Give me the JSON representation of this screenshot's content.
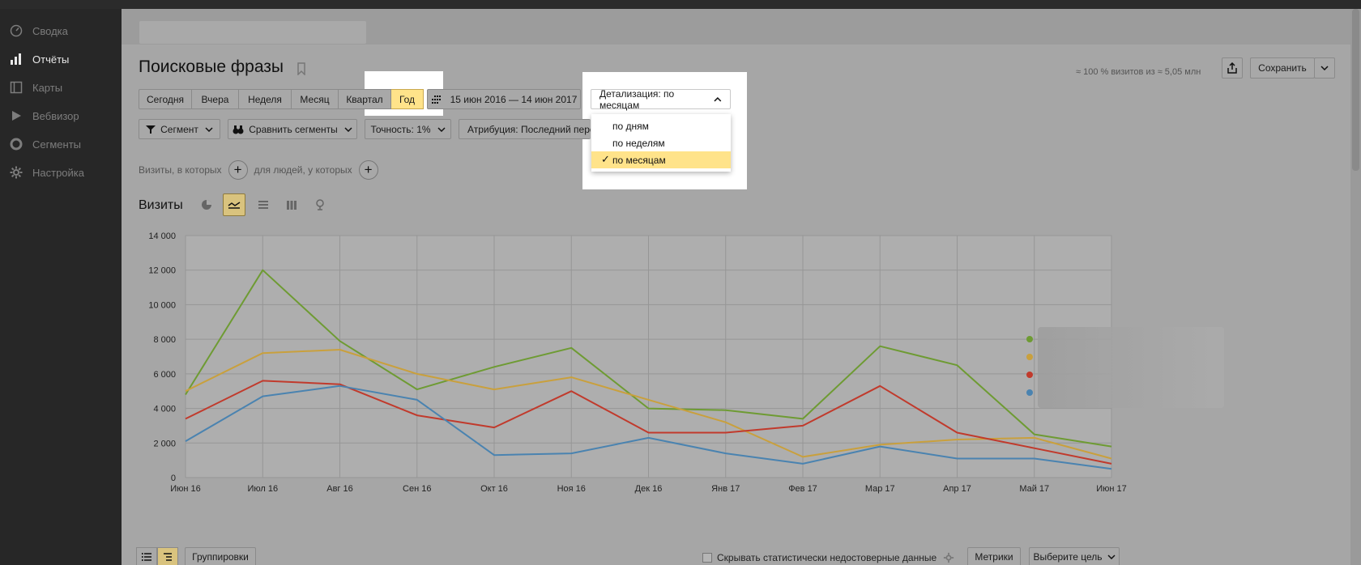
{
  "sidebar": {
    "items": [
      {
        "label": "Сводка",
        "icon": "dashboard-icon"
      },
      {
        "label": "Отчёты",
        "icon": "bar-chart-icon"
      },
      {
        "label": "Карты",
        "icon": "map-icon"
      },
      {
        "label": "Вебвизор",
        "icon": "play-icon"
      },
      {
        "label": "Сегменты",
        "icon": "segments-icon"
      },
      {
        "label": "Настройка",
        "icon": "gear-icon"
      }
    ]
  },
  "page": {
    "title": "Поисковые фразы",
    "visits_info": "≈ 100 % визитов из ≈ 5,05 млн",
    "save_label": "Сохранить"
  },
  "periods": [
    "Сегодня",
    "Вчера",
    "Неделя",
    "Месяц",
    "Квартал",
    "Год"
  ],
  "date_range": "15 июн 2016 — 14 июн 2017",
  "detail": {
    "label": "Детализация: по месяцам",
    "options": [
      "по дням",
      "по неделям",
      "по месяцам"
    ],
    "selected": "по месяцам"
  },
  "filters": {
    "segment": "Сегмент",
    "compare": "Сравнить сегменты",
    "accuracy": "Точность: 1%",
    "attribution": "Атрибуция: Последний перех"
  },
  "condition": {
    "visits_where": "Визиты, в которых",
    "people_where": "для людей, у которых"
  },
  "chart_title": "Визиты",
  "bottom": {
    "groupings": "Группировки",
    "hide_unreliable": "Скрывать статистически недостоверные данные",
    "metrics": "Метрики",
    "goal": "Выберите цель"
  },
  "colors": {
    "green": "#6e9b33",
    "yellow": "#c9a03d",
    "red": "#c13a2c",
    "blue": "#4a83b0",
    "highlight": "#ffe38a"
  },
  "chart_data": {
    "type": "line",
    "categories": [
      "Июн 16",
      "Июл 16",
      "Авг 16",
      "Сен 16",
      "Окт 16",
      "Ноя 16",
      "Дек 16",
      "Янв 17",
      "Фев 17",
      "Мар 17",
      "Апр 17",
      "Май 17",
      "Июн 17"
    ],
    "ylim": [
      0,
      14000
    ],
    "yticks": [
      "0",
      "2 000",
      "4 000",
      "6 000",
      "8 000",
      "10 000",
      "12 000",
      "14 000"
    ],
    "grid": true,
    "legend_position": "right",
    "series": [
      {
        "color": "#6e9b33",
        "values": [
          4800,
          12000,
          7900,
          5100,
          6400,
          7500,
          4000,
          3900,
          3400,
          7600,
          6500,
          2500,
          1800
        ]
      },
      {
        "color": "#c9a03d",
        "values": [
          5000,
          7200,
          7400,
          6000,
          5100,
          5800,
          4500,
          3200,
          1200,
          1900,
          2200,
          2300,
          1100
        ]
      },
      {
        "color": "#c13a2c",
        "values": [
          3400,
          5600,
          5400,
          3600,
          2900,
          5000,
          2600,
          2600,
          3000,
          5300,
          2600,
          1700,
          800
        ]
      },
      {
        "color": "#4a83b0",
        "values": [
          2100,
          4700,
          5300,
          4500,
          1300,
          1400,
          2300,
          1400,
          800,
          1800,
          1100,
          1100,
          500
        ]
      }
    ]
  }
}
